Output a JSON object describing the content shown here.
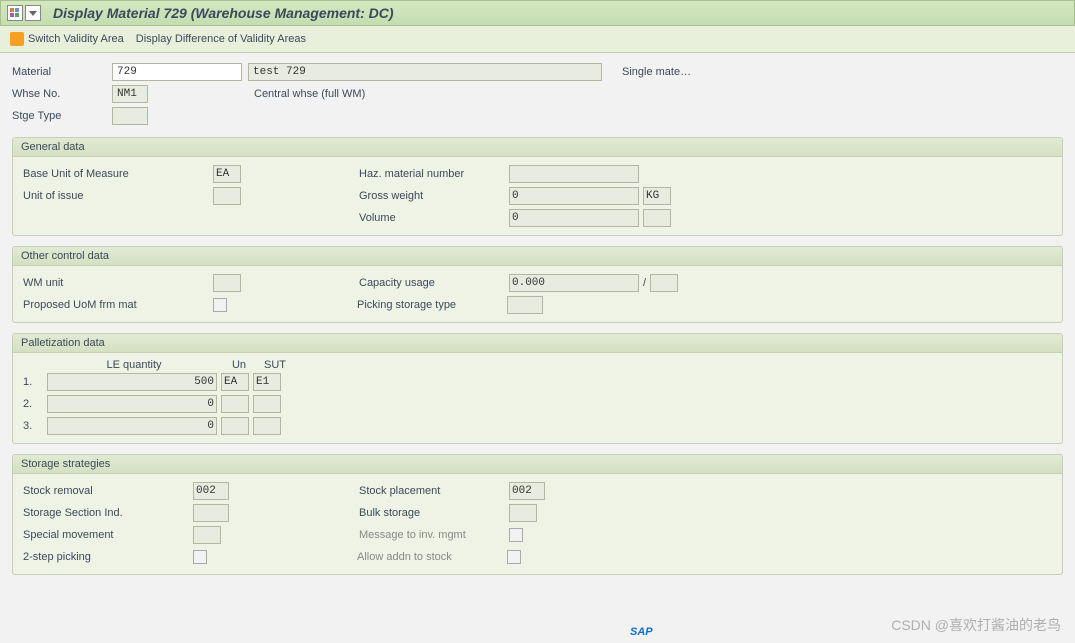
{
  "title": "Display Material 729 (Warehouse Management: DC)",
  "toolbar": {
    "switch_validity": "Switch Validity Area",
    "display_diff": "Display Difference of Validity Areas"
  },
  "header": {
    "material_label": "Material",
    "material_value": "729",
    "material_desc": "test 729",
    "material_extra": "Single mate…",
    "whse_label": "Whse No.",
    "whse_value": "NM1",
    "whse_desc": "Central whse (full WM)",
    "stge_label": "Stge Type",
    "stge_value": ""
  },
  "general": {
    "title": "General data",
    "base_uom_label": "Base Unit of Measure",
    "base_uom_value": "EA",
    "haz_label": "Haz. material number",
    "haz_value": "",
    "unit_issue_label": "Unit of issue",
    "unit_issue_value": "",
    "gross_wt_label": "Gross weight",
    "gross_wt_value": "0",
    "gross_wt_unit": "KG",
    "volume_label": "Volume",
    "volume_value": "0",
    "volume_unit": ""
  },
  "other": {
    "title": "Other control data",
    "wm_unit_label": "WM unit",
    "wm_unit_value": "",
    "cap_label": "Capacity usage",
    "cap_value": "0.000",
    "cap_sep": "/",
    "cap_unit": "",
    "proposed_label": "Proposed UoM frm mat",
    "picking_label": "Picking storage type",
    "picking_value": ""
  },
  "pallet": {
    "title": "Palletization data",
    "h_qty": "LE quantity",
    "h_un": "Un",
    "h_sut": "SUT",
    "rows": [
      {
        "n": "1.",
        "qty": "500",
        "un": "EA",
        "sut": "E1"
      },
      {
        "n": "2.",
        "qty": "0",
        "un": "",
        "sut": ""
      },
      {
        "n": "3.",
        "qty": "0",
        "un": "",
        "sut": ""
      }
    ]
  },
  "storage": {
    "title": "Storage strategies",
    "removal_label": "Stock removal",
    "removal_value": "002",
    "placement_label": "Stock placement",
    "placement_value": "002",
    "section_label": "Storage Section Ind.",
    "section_value": "",
    "bulk_label": "Bulk storage",
    "bulk_value": "",
    "special_label": "Special movement",
    "special_value": "",
    "msg_label": "Message to inv. mgmt",
    "step_label": "2-step picking",
    "addn_label": "Allow addn to stock"
  },
  "watermark": "CSDN @喜欢打酱油的老鸟"
}
